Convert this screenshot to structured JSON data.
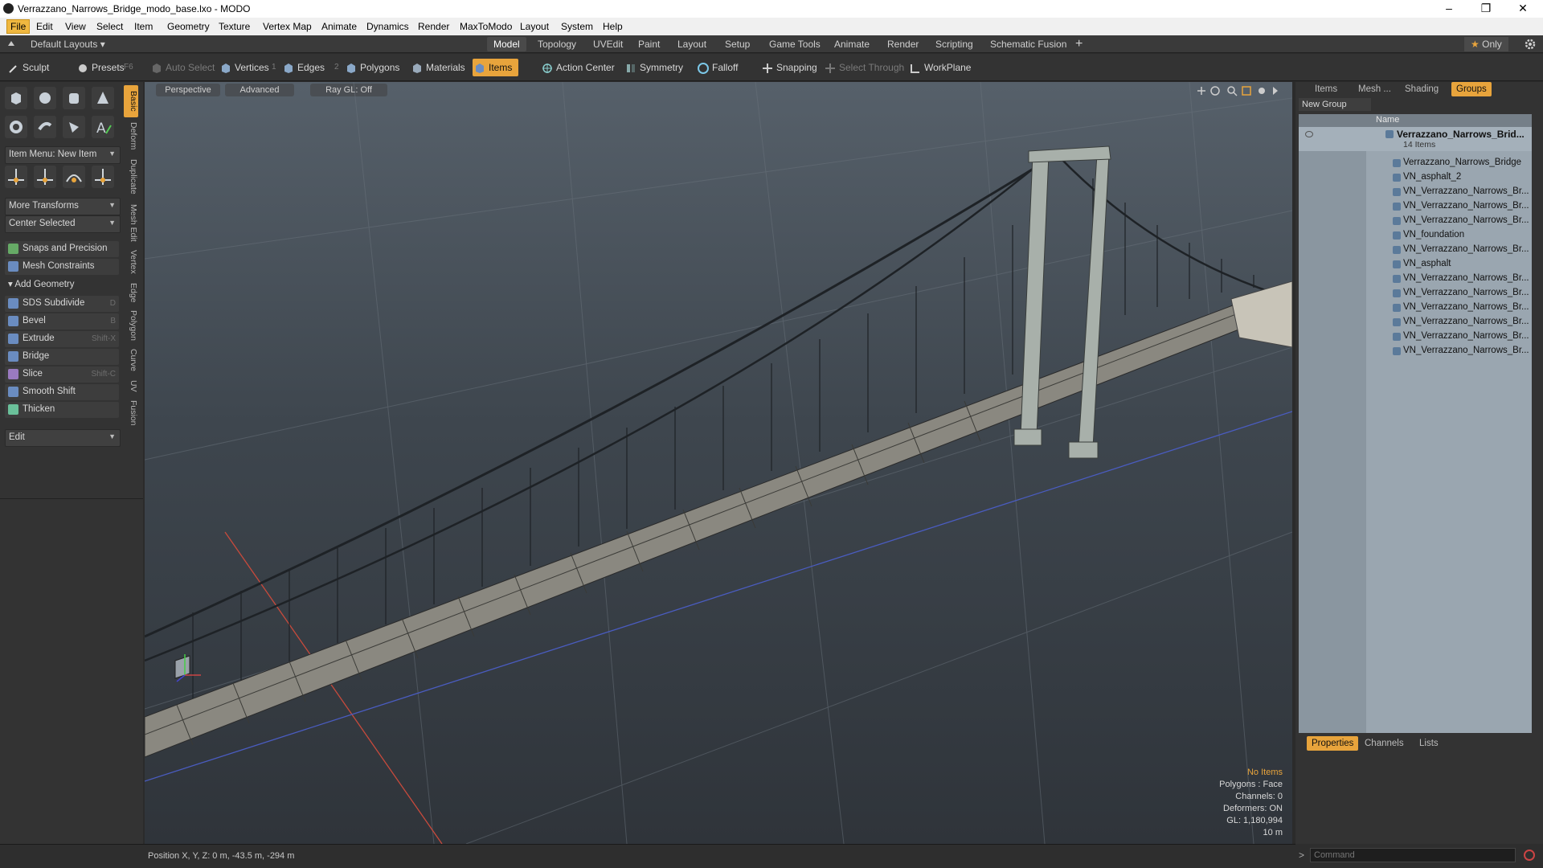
{
  "window": {
    "title": "Verrazzano_Narrows_Bridge_modo_base.lxo - MODO",
    "controls": {
      "minimize": "–",
      "restore": "❐",
      "close": "✕"
    }
  },
  "menubar": {
    "items": [
      "File",
      "Edit",
      "View",
      "Select",
      "Item",
      "Geometry",
      "Texture",
      "Vertex Map",
      "Animate",
      "Dynamics",
      "Render",
      "MaxToModo",
      "Layout",
      "System",
      "Help"
    ],
    "active": "File"
  },
  "layout_bar": {
    "layouts_label": "Default Layouts",
    "tabs": [
      "Model",
      "Topology",
      "UVEdit",
      "Paint",
      "Layout",
      "Setup",
      "Game Tools",
      "Animate",
      "Render",
      "Scripting",
      "Schematic Fusion"
    ],
    "active_tab": "Model",
    "add_label": "+",
    "only_label": "Only",
    "star": "★"
  },
  "toolbar": {
    "sculpt": "Sculpt",
    "presets": "Presets",
    "presets_key": "F6",
    "auto_select": "Auto Select",
    "vertices": "Vertices",
    "vertices_key": "1",
    "edges": "Edges",
    "edges_key": "2",
    "polygons": "Polygons",
    "materials": "Materials",
    "items": "Items",
    "action_center": "Action Center",
    "symmetry": "Symmetry",
    "falloff": "Falloff",
    "snapping": "Snapping",
    "select_through": "Select Through",
    "workplane": "WorkPlane"
  },
  "left_panel": {
    "item_menu": "Item Menu: New Item",
    "more_transforms": "More Transforms",
    "center_selected": "Center Selected",
    "snaps": "Snaps and Precision",
    "mesh_constraints": "Mesh Constraints",
    "add_geometry": "Add Geometry",
    "tools": [
      {
        "label": "SDS Subdivide",
        "key": "D"
      },
      {
        "label": "Bevel",
        "key": "B"
      },
      {
        "label": "Extrude",
        "key": "Shift-X"
      },
      {
        "label": "Bridge",
        "key": ""
      },
      {
        "label": "Slice",
        "key": "Shift-C"
      },
      {
        "label": "Smooth Shift",
        "key": ""
      },
      {
        "label": "Thicken",
        "key": ""
      }
    ],
    "edit": "Edit",
    "vertical_tabs": [
      "Basic",
      "Deform",
      "Duplicate",
      "Mesh Edit",
      "Vertex",
      "Edge",
      "Polygon",
      "Curve",
      "UV",
      "Fusion"
    ]
  },
  "viewport": {
    "view_mode": "Perspective",
    "shading": "Advanced",
    "raygl": "Ray GL: Off",
    "hud": {
      "no_items": "No Items",
      "polygons": "Polygons : Face",
      "channels": "Channels: 0",
      "deformers": "Deformers: ON",
      "gl": "GL: 1,180,994",
      "scale": "10 m"
    }
  },
  "right_panel": {
    "tabs": [
      "Items",
      "Mesh ...",
      "Shading",
      "Groups"
    ],
    "active_tab": "Groups",
    "new_group": "New Group",
    "name_header": "Name",
    "group_name": "Verrazzano_Narrows_Brid...",
    "group_count": "14 Items",
    "rows": [
      "Verrazzano_Narrows_Bridge",
      "VN_asphalt_2",
      "VN_Verrazzano_Narrows_Br...",
      "VN_Verrazzano_Narrows_Br...",
      "VN_Verrazzano_Narrows_Br...",
      "VN_foundation",
      "VN_Verrazzano_Narrows_Br...",
      "VN_asphalt",
      "VN_Verrazzano_Narrows_Br...",
      "VN_Verrazzano_Narrows_Br...",
      "VN_Verrazzano_Narrows_Br...",
      "VN_Verrazzano_Narrows_Br...",
      "VN_Verrazzano_Narrows_Br...",
      "VN_Verrazzano_Narrows_Br..."
    ],
    "bottom_tabs": [
      "Properties",
      "Channels",
      "Lists"
    ],
    "bottom_active": "Properties"
  },
  "statusbar": {
    "position": "Position X, Y, Z:  0 m, -43.5 m, -294 m",
    "command_placeholder": "Command"
  },
  "colors": {
    "accent": "#e8a43c",
    "viewport_top": "#56606a",
    "viewport_bottom": "#2f343a"
  }
}
